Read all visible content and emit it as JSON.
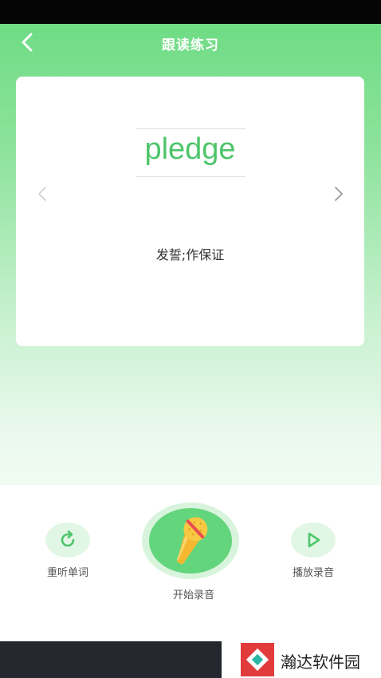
{
  "header": {
    "title": "跟读练习",
    "back_icon": "chevron-left-icon"
  },
  "card": {
    "word": "pledge",
    "meaning": "发誓;作保证",
    "prev_icon": "chevron-left-icon",
    "next_icon": "chevron-right-icon"
  },
  "controls": {
    "replay_label": "重听单词",
    "record_label": "开始录音",
    "play_label": "播放录音",
    "replay_icon": "refresh-icon",
    "record_icon": "microphone-icon",
    "play_icon": "play-icon"
  },
  "watermark": {
    "text": "瀚达软件园"
  },
  "colors": {
    "accent": "#63d57c",
    "word": "#4dc56a",
    "header_top": "#6fdc85"
  }
}
